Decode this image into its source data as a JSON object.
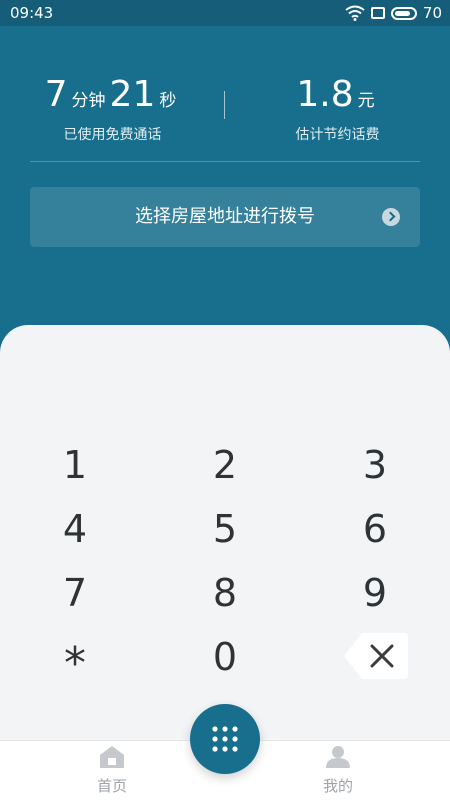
{
  "status_bar": {
    "time": "09:43",
    "battery": "70"
  },
  "header": {
    "minutes_value": "7",
    "minutes_unit": "分钟",
    "seconds_value": "21",
    "seconds_unit": "秒",
    "free_calls_caption": "已使用免费通话",
    "savings_value": "1.8",
    "savings_unit": "元",
    "savings_caption": "估计节约话费",
    "address_button_label": "选择房屋地址进行拨号"
  },
  "keypad": {
    "keys": [
      "1",
      "2",
      "3",
      "4",
      "5",
      "6",
      "7",
      "8",
      "9",
      "*",
      "0"
    ]
  },
  "bottom_nav": {
    "home_label": "首页",
    "mine_label": "我的"
  },
  "colors": {
    "primary": "#176e8d",
    "status_bar": "#155d78",
    "panel_bg": "#f3f4f5",
    "nav_inactive": "#9ea3a8"
  },
  "icons": {
    "wifi": "wifi-icon",
    "screen": "screen-icon",
    "battery": "battery-icon",
    "arrow": "chevron-right-circle-icon",
    "backspace": "backspace-icon",
    "home": "home-icon",
    "profile": "person-icon",
    "dialpad": "dialpad-grid-icon"
  }
}
